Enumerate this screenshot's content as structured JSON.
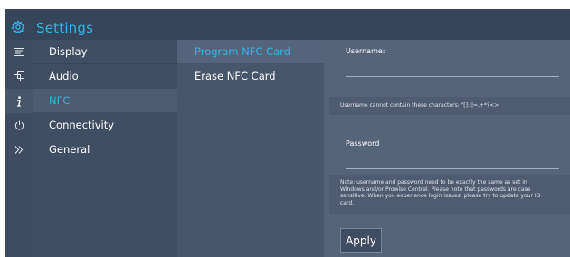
{
  "header": {
    "title": "Settings",
    "icon": "gear-icon"
  },
  "iconbar": [
    "display-icon",
    "audio-icon",
    "info-icon",
    "power-icon",
    "chevrons-right-icon"
  ],
  "menu": {
    "items": [
      {
        "label": "Display"
      },
      {
        "label": "Audio"
      },
      {
        "label": "NFC"
      },
      {
        "label": "Connectivity"
      },
      {
        "label": "General"
      }
    ],
    "selected": "NFC"
  },
  "submenu": {
    "items": [
      {
        "label": "Program NFC Card"
      },
      {
        "label": "Erase NFC Card"
      }
    ],
    "selected": "Program NFC Card"
  },
  "form": {
    "username_label": "Username:",
    "username_value": "",
    "username_hint": "Username cannot contain these characters: \"[]:;|=,+*?<>",
    "password_label": "Password",
    "password_value": "",
    "note": "Note: username and password need to be exactly the same as set in Windows and/or Prowise Central. Please note that passwords are case sensitive. When you experience login issues, please try to update your ID card.",
    "apply_label": "Apply"
  },
  "colors": {
    "accent": "#30b6e6",
    "header_bg": "#35455a",
    "menu_bg": "#3f4f63",
    "content_bg": "#54657a"
  }
}
